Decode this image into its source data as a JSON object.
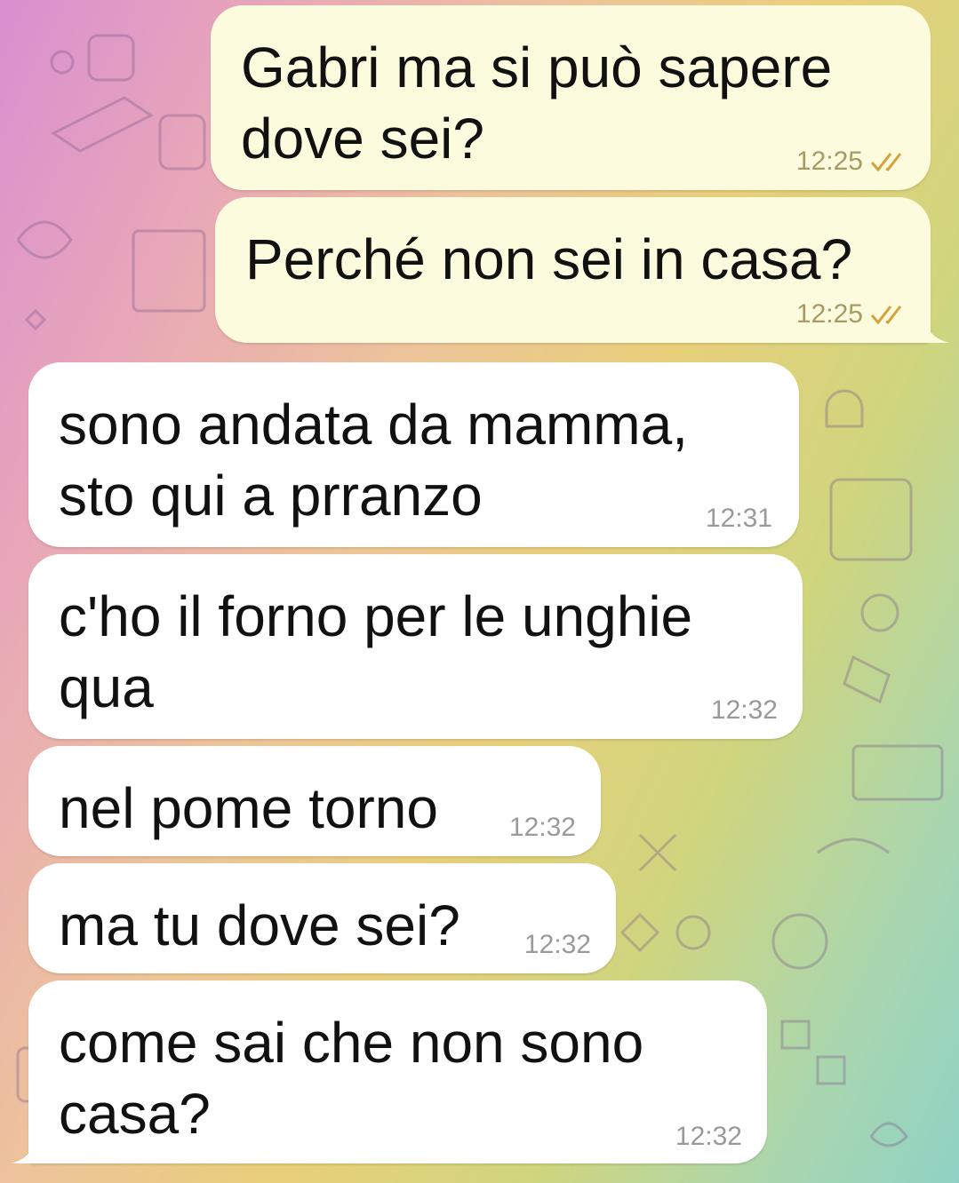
{
  "theme": {
    "outgoing_bubble": "#fdfbdd",
    "incoming_bubble": "#ffffff",
    "check_color": "#d4a23c"
  },
  "messages": [
    {
      "direction": "out",
      "text": "Gabri ma si può sapere\ndove sei?",
      "time": "12:25",
      "status": "read"
    },
    {
      "direction": "out",
      "text": "Perché non sei in casa?",
      "time": "12:25",
      "status": "read"
    },
    {
      "direction": "in",
      "text": "sono andata da mamma,\nsto qui a prranzo",
      "time": "12:31"
    },
    {
      "direction": "in",
      "text": "c'ho il forno per le unghie\nqua",
      "time": "12:32"
    },
    {
      "direction": "in",
      "text": "nel pome torno",
      "time": "12:32"
    },
    {
      "direction": "in",
      "text": "ma tu dove sei?",
      "time": "12:32"
    },
    {
      "direction": "in",
      "text": "come sai che non sono\ncasa?",
      "time": "12:32"
    }
  ]
}
